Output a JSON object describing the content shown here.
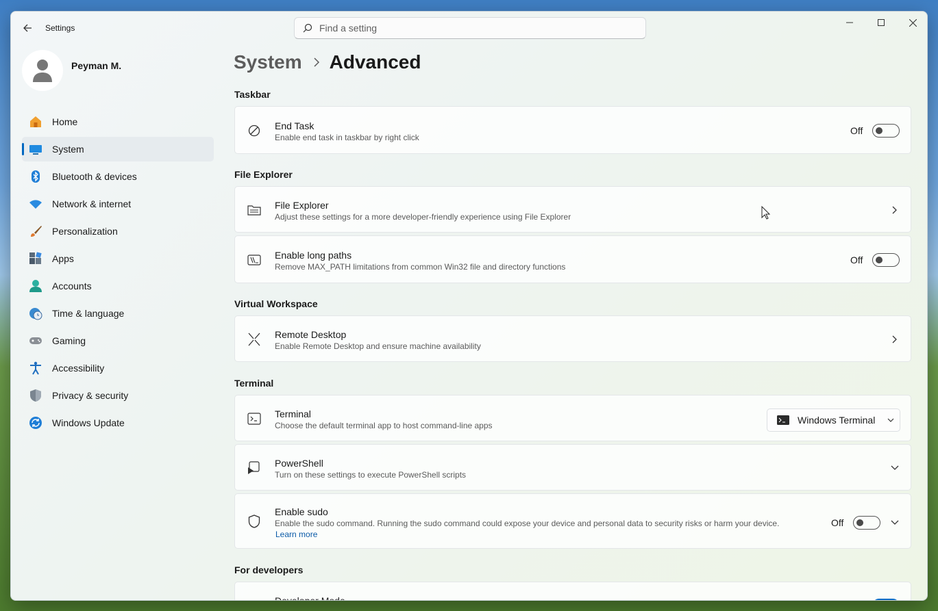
{
  "window": {
    "title": "Settings"
  },
  "search": {
    "placeholder": "Find a setting"
  },
  "profile": {
    "name": "Peyman M."
  },
  "sidebar": {
    "items": [
      {
        "label": "Home",
        "icon": "home-icon"
      },
      {
        "label": "System",
        "icon": "system-icon",
        "selected": true
      },
      {
        "label": "Bluetooth & devices",
        "icon": "bluetooth-icon"
      },
      {
        "label": "Network & internet",
        "icon": "wifi-icon"
      },
      {
        "label": "Personalization",
        "icon": "brush-icon"
      },
      {
        "label": "Apps",
        "icon": "apps-icon"
      },
      {
        "label": "Accounts",
        "icon": "accounts-icon"
      },
      {
        "label": "Time & language",
        "icon": "clock-globe-icon"
      },
      {
        "label": "Gaming",
        "icon": "gamepad-icon"
      },
      {
        "label": "Accessibility",
        "icon": "accessibility-icon"
      },
      {
        "label": "Privacy & security",
        "icon": "shield-icon"
      },
      {
        "label": "Windows Update",
        "icon": "update-icon"
      }
    ]
  },
  "breadcrumb": {
    "parent": "System",
    "current": "Advanced"
  },
  "sections": {
    "taskbar": "Taskbar",
    "file_explorer": "File Explorer",
    "virtual_workspace": "Virtual Workspace",
    "terminal": "Terminal",
    "for_developers": "For developers"
  },
  "settings": {
    "end_task": {
      "title": "End Task",
      "desc": "Enable end task in taskbar by right click",
      "state": "Off"
    },
    "file_explorer": {
      "title": "File Explorer",
      "desc": "Adjust these settings for a more developer-friendly experience using File Explorer"
    },
    "long_paths": {
      "title": "Enable long paths",
      "desc": "Remove MAX_PATH limitations from common Win32 file and directory functions",
      "state": "Off"
    },
    "remote_desktop": {
      "title": "Remote Desktop",
      "desc": "Enable Remote Desktop and ensure machine availability"
    },
    "terminal": {
      "title": "Terminal",
      "desc": "Choose the default terminal app to host command-line apps",
      "selected": "Windows Terminal"
    },
    "powershell": {
      "title": "PowerShell",
      "desc": "Turn on these settings to execute PowerShell scripts"
    },
    "sudo": {
      "title": "Enable sudo",
      "desc": "Enable the sudo command. Running the sudo command could expose your device and personal data to security risks or harm your device.",
      "link": "Learn more",
      "state": "Off"
    },
    "developer_mode": {
      "title": "Developer Mode"
    }
  },
  "colors": {
    "accent": "#0067c0",
    "link": "#0a5aa8"
  }
}
